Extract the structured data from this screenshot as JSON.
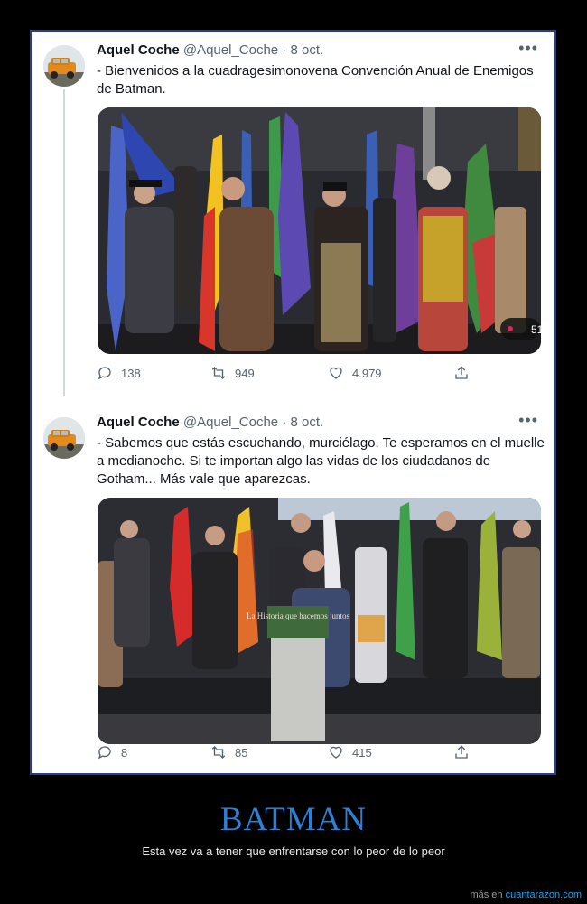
{
  "tweets": [
    {
      "name": "Aquel Coche",
      "handle": "@Aquel_Coche",
      "separator": "·",
      "date": "8 oct.",
      "text": "- Bienvenidos a la cuadragesimonovena Convención Anual de Enemigos de Batman.",
      "video_overlay": "51",
      "replies": "138",
      "retweets": "949",
      "likes": "4.979"
    },
    {
      "name": "Aquel Coche",
      "handle": "@Aquel_Coche",
      "separator": "·",
      "date": "8 oct.",
      "text": "- Sabemos que estás escuchando, murciélago. Te esperamos en el muelle a medianoche. Si te importan algo las vidas de los ciudadanos de Gotham... Más vale que aparezcas.",
      "podium_sign": "La Historia que hacemos juntos",
      "replies": "8",
      "retweets": "85",
      "likes": "415"
    }
  ],
  "caption": {
    "title": "BATMAN",
    "subtitle": "Esta vez va a tener que enfrentarse con lo peor de lo peor"
  },
  "footer": {
    "prefix": "más en",
    "site": "cuantarazon.com"
  },
  "colors": {
    "accent": "#2f7fd3",
    "card_border": "#2b3d8f",
    "link": "#1da1f2"
  }
}
